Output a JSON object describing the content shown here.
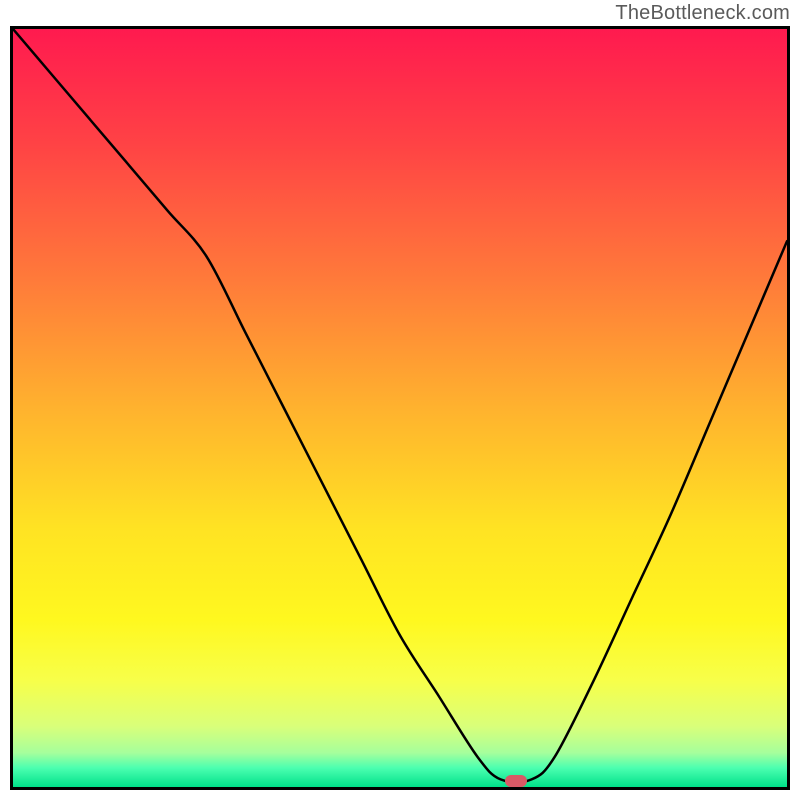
{
  "attribution": "TheBottleneck.com",
  "chart_data": {
    "type": "line",
    "title": "",
    "xlabel": "",
    "ylabel": "",
    "xlim": [
      0,
      100
    ],
    "ylim": [
      0,
      100
    ],
    "x": [
      0,
      5,
      10,
      15,
      20,
      25,
      30,
      35,
      40,
      45,
      50,
      55,
      60,
      63,
      67,
      70,
      75,
      80,
      85,
      90,
      95,
      100
    ],
    "values": [
      100,
      94,
      88,
      82,
      76,
      70,
      60,
      50,
      40,
      30,
      20,
      12,
      4,
      1,
      1,
      4,
      14,
      25,
      36,
      48,
      60,
      72
    ],
    "marker": {
      "x": 65,
      "y": 0.8
    },
    "gradient_stops": [
      {
        "offset": 0.0,
        "color": "#ff1a4f"
      },
      {
        "offset": 0.15,
        "color": "#ff4245"
      },
      {
        "offset": 0.33,
        "color": "#ff7a3a"
      },
      {
        "offset": 0.5,
        "color": "#ffb22e"
      },
      {
        "offset": 0.66,
        "color": "#ffe323"
      },
      {
        "offset": 0.78,
        "color": "#fff81f"
      },
      {
        "offset": 0.86,
        "color": "#f7ff4a"
      },
      {
        "offset": 0.92,
        "color": "#d9ff7a"
      },
      {
        "offset": 0.955,
        "color": "#a6ff9c"
      },
      {
        "offset": 0.975,
        "color": "#4bffb0"
      },
      {
        "offset": 1.0,
        "color": "#00e08a"
      }
    ]
  }
}
